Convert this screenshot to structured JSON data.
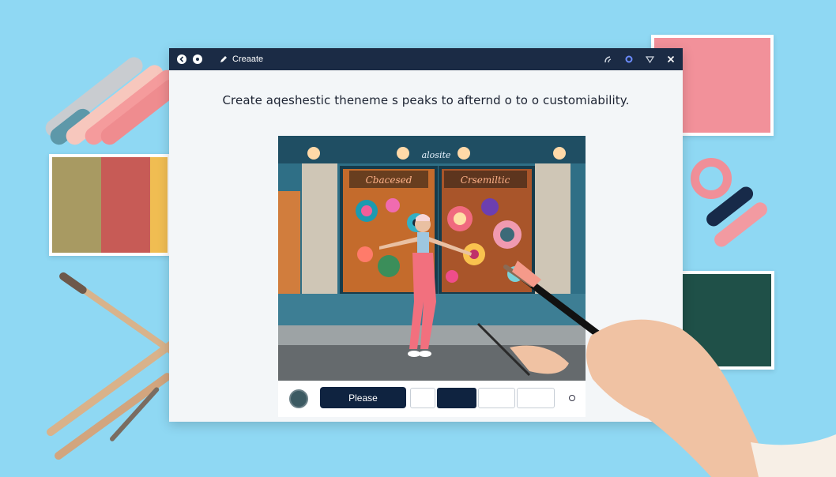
{
  "window": {
    "title": "Creaate",
    "headline": "Create aqeshestic theneme s peaks to afternd o to o customiability."
  },
  "photo": {
    "sign_top": "alosite",
    "sign_left": "Cbacesed",
    "sign_right": "Crsemiltic"
  },
  "toolbar": {
    "primary_button": "Please"
  },
  "colors": {
    "background": "#8fd8f3",
    "titlebar": "#1b2b45",
    "accent": "#0f2340",
    "pink": "#f39aa0",
    "green": "#1f5048"
  }
}
